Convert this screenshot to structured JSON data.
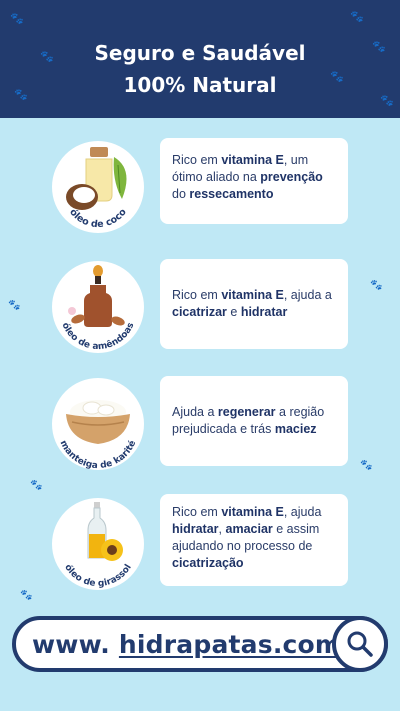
{
  "header": {
    "title_line1": "Seguro e Saudável",
    "title_line2": "100% Natural"
  },
  "items": [
    {
      "label": "óleo de coco",
      "text_parts": [
        "Rico em ",
        "vitamina E",
        ", um ótimo aliado na ",
        "prevenção",
        " do ",
        "ressecamento"
      ]
    },
    {
      "label": "óleo de amêndoas",
      "text_parts": [
        "Rico em ",
        "vitamina E",
        ", ajuda a ",
        "cicatrizar",
        " e ",
        "hidratar"
      ]
    },
    {
      "label": "manteiga de karité",
      "text_parts": [
        "Ajuda a ",
        "regenerar",
        " a região prejudicada e trás ",
        "maciez"
      ]
    },
    {
      "label": "óleo de girassol",
      "text_parts": [
        "Rico em ",
        "vitamina E",
        ", ajuda ",
        "hidratar",
        ", ",
        "amaciar",
        " e assim ajudando no processo de ",
        "cicatrização"
      ]
    }
  ],
  "search": {
    "prefix": "www.",
    "domain": "hidrapatas.com.br"
  },
  "colors": {
    "navy": "#223b6e",
    "sky": "#bfe8f5",
    "card": "#ffffff"
  },
  "icons": [
    "paw-icon",
    "search-icon"
  ]
}
